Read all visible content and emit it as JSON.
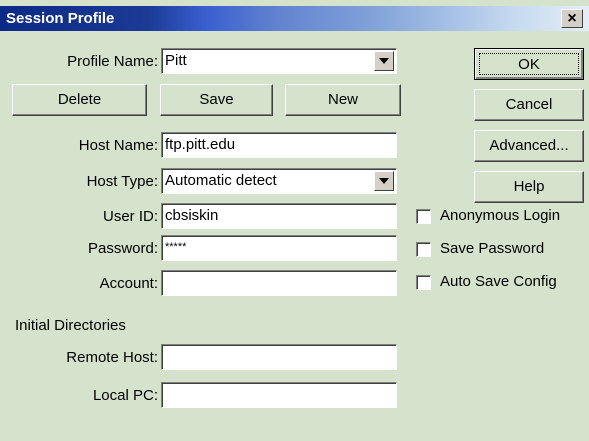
{
  "window": {
    "title": "Session Profile",
    "close_glyph": "×"
  },
  "labels": {
    "profile_name": "Profile Name:",
    "host_name": "Host Name:",
    "host_type": "Host Type:",
    "user_id": "User ID:",
    "password": "Password:",
    "account": "Account:",
    "initial_dirs": "Initial Directories",
    "remote_host": "Remote Host:",
    "local_pc": "Local PC:"
  },
  "fields": {
    "profile_name": "Pitt",
    "host_name": "ftp.pitt.edu",
    "host_type": "Automatic detect",
    "user_id": "cbsiskin",
    "password": "*****",
    "account": "",
    "remote_host": "",
    "local_pc": ""
  },
  "buttons": {
    "ok": "OK",
    "cancel": "Cancel",
    "advanced": "Advanced...",
    "help": "Help",
    "delete": "Delete",
    "save": "Save",
    "new": "New"
  },
  "checkboxes": {
    "anonymous_login": {
      "label": "Anonymous Login",
      "checked": false
    },
    "save_password": {
      "label": "Save Password",
      "checked": false
    },
    "auto_save_config": {
      "label": "Auto Save Config",
      "checked": false
    }
  },
  "colors": {
    "dialog_bg": "#d5e3cd",
    "title_start": "#0b2a86",
    "title_end": "#e4eef9"
  }
}
